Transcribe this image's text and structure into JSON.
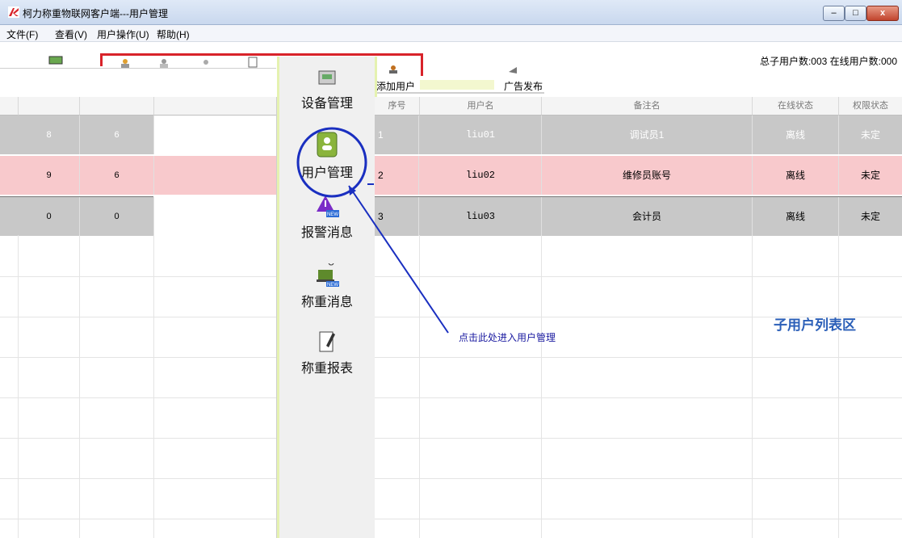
{
  "window": {
    "title": "柯力称重物联网客户端---用户管理",
    "minimize": "–",
    "maximize": "□",
    "close": "x"
  },
  "menu": [
    "文件(F)",
    "查看(V)",
    "用户操作(U)",
    "帮助(H)"
  ],
  "toolbar": {
    "actions": [
      "添加用户",
      "广告发布"
    ],
    "user_count": "总子用户数:003 在线用户数:000"
  },
  "nav": [
    {
      "label": "设备管理",
      "icon": "device-management-icon"
    },
    {
      "label": "用户管理",
      "icon": "user-management-icon"
    },
    {
      "label": "报警消息",
      "icon": "alarm-message-icon"
    },
    {
      "label": "称重消息",
      "icon": "weighing-message-icon"
    },
    {
      "label": "称重报表",
      "icon": "weighing-report-icon"
    }
  ],
  "left_grid": {
    "rows": [
      {
        "c1": "8",
        "c2": "6",
        "style": "gray"
      },
      {
        "c1": "9",
        "c2": "6",
        "style": "pink"
      },
      {
        "c1": "0",
        "c2": "0",
        "style": "gray"
      }
    ]
  },
  "right_grid": {
    "headers": [
      "序号",
      "用户名",
      "备注名",
      "在线状态",
      "权限状态"
    ],
    "rows": [
      {
        "no": "1",
        "user": "liu01",
        "remark": "调试员1",
        "status": "离线",
        "perm": "未定",
        "style": "gray"
      },
      {
        "no": "2",
        "user": "liu02",
        "remark": "维修员账号",
        "status": "离线",
        "perm": "未定",
        "style": "pink"
      },
      {
        "no": "3",
        "user": "liu03",
        "remark": "会计员",
        "status": "离线",
        "perm": "未定",
        "style": "gray"
      }
    ]
  },
  "annotations": {
    "hint": "点击此处进入用户管理",
    "area_label": "子用户列表区"
  },
  "colors": {
    "row_gray": "#c8c8c8",
    "row_pink": "#f8c9cc",
    "annotation_blue": "#1a2fc0",
    "toolbar_red": "#d8232a"
  }
}
